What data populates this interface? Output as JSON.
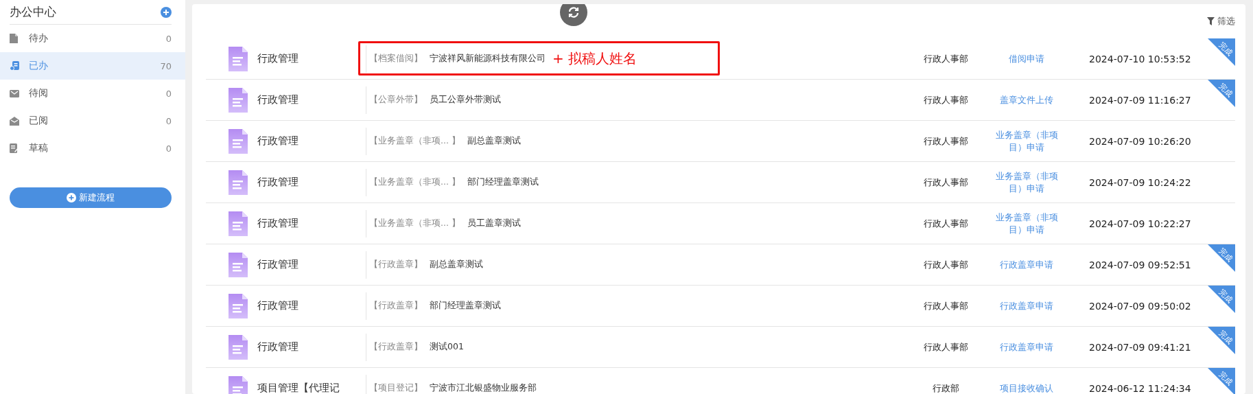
{
  "sidebar": {
    "title": "办公中心",
    "items": [
      {
        "label": "待办",
        "count": "0",
        "selected": false
      },
      {
        "label": "已办",
        "count": "70",
        "selected": true
      },
      {
        "label": "待阅",
        "count": "0",
        "selected": false
      },
      {
        "label": "已阅",
        "count": "0",
        "selected": false
      },
      {
        "label": "草稿",
        "count": "0",
        "selected": false
      }
    ],
    "new_button": "新建流程"
  },
  "toolbar": {
    "filter": "筛选"
  },
  "rows": [
    {
      "title": "行政管理",
      "tag": "【档案借阅】",
      "subject": "宁波祥风新能源科技有限公司",
      "annotation": "+ 拟稿人姓名",
      "department": "行政人事部",
      "type": "借阅申请",
      "time": "2024-07-10 10:53:52",
      "badge": "完成"
    },
    {
      "title": "行政管理",
      "tag": "【公章外带】",
      "subject": "员工公章外带测试",
      "department": "行政人事部",
      "type": "盖章文件上传",
      "time": "2024-07-09 11:16:27",
      "badge": "完成"
    },
    {
      "title": "行政管理",
      "tag": "【业务盖章（非项... 】",
      "subject": "副总盖章测试",
      "department": "行政人事部",
      "type": "业务盖章（非项目）申请",
      "time": "2024-07-09 10:26:20"
    },
    {
      "title": "行政管理",
      "tag": "【业务盖章（非项... 】",
      "subject": "部门经理盖章测试",
      "department": "行政人事部",
      "type": "业务盖章（非项目）申请",
      "time": "2024-07-09 10:24:22"
    },
    {
      "title": "行政管理",
      "tag": "【业务盖章（非项... 】",
      "subject": "员工盖章测试",
      "department": "行政人事部",
      "type": "业务盖章（非项目）申请",
      "time": "2024-07-09 10:22:27"
    },
    {
      "title": "行政管理",
      "tag": "【行政盖章】",
      "subject": "副总盖章测试",
      "department": "行政人事部",
      "type": "行政盖章申请",
      "time": "2024-07-09 09:52:51",
      "badge": "完成"
    },
    {
      "title": "行政管理",
      "tag": "【行政盖章】",
      "subject": "部门经理盖章测试",
      "department": "行政人事部",
      "type": "行政盖章申请",
      "time": "2024-07-09 09:50:02",
      "badge": "完成"
    },
    {
      "title": "行政管理",
      "tag": "【行政盖章】",
      "subject": "测试001",
      "department": "行政人事部",
      "type": "行政盖章申请",
      "time": "2024-07-09 09:41:21",
      "badge": "完成"
    },
    {
      "title": "项目管理【代理记",
      "tag": "【项目登记】",
      "subject": "宁波市江北银盛物业服务部",
      "department": "行政部",
      "type": "项目接收确认",
      "time": "2024-06-12 11:24:34",
      "badge": "完成"
    }
  ]
}
